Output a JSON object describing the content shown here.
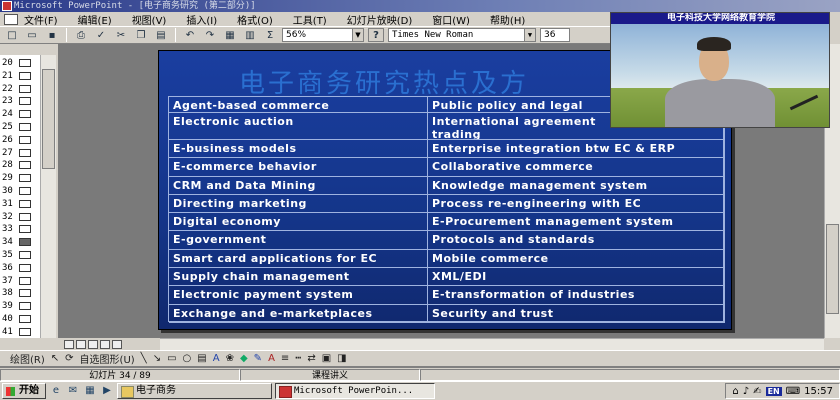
{
  "window": {
    "title": "Microsoft PowerPoint - [电子商务研究 (第二部分)]"
  },
  "menu": [
    "文件(F)",
    "编辑(E)",
    "视图(V)",
    "插入(I)",
    "格式(O)",
    "工具(T)",
    "幻灯片放映(D)",
    "窗口(W)",
    "帮助(H)"
  ],
  "toolbar": {
    "zoom": "56%",
    "font": "Times New Roman",
    "font_size": "36",
    "sum_icon": "Σ",
    "help_icon": "?"
  },
  "outline": {
    "rows": [
      "20",
      "21",
      "22",
      "23",
      "24",
      "25",
      "26",
      "27",
      "28",
      "29",
      "30",
      "31",
      "32",
      "33",
      "34",
      "35",
      "36",
      "37",
      "38",
      "39",
      "40",
      "41"
    ],
    "selected": "34"
  },
  "slide": {
    "title": "电子商务研究热点及方",
    "left": [
      "Agent-based commerce",
      "Electronic auction",
      "E-business models",
      "E-commerce behavior",
      "CRM and Data Mining",
      "Directing marketing",
      "Digital economy",
      "E-government",
      "Smart card applications for EC",
      "Supply chain management",
      "Electronic payment system",
      "Exchange and e-marketplaces"
    ],
    "right": [
      "Public policy and legal",
      "International agreement trading",
      "Enterprise integration btw EC & ERP",
      "Collaborative commerce",
      "Knowledge management system",
      "Process re-engineering with EC",
      "E-Procurement management system",
      "Protocols and standards",
      "Mobile commerce",
      "XML/EDI",
      "E-transformation of industries",
      "Security and trust"
    ]
  },
  "webcam": {
    "label": "电子科技大学网络教育学院"
  },
  "drawbar": {
    "draw_label": "绘图(R)",
    "autoshape_label": "自选图形(U)"
  },
  "status": {
    "slide_counter": "幻灯片 34 / 89",
    "template": "课程讲义"
  },
  "taskbar": {
    "start_label": "开始",
    "tasks": [
      "电子商务",
      "Microsoft PowerPoin..."
    ],
    "lang": "EN",
    "clock": "15:57"
  }
}
